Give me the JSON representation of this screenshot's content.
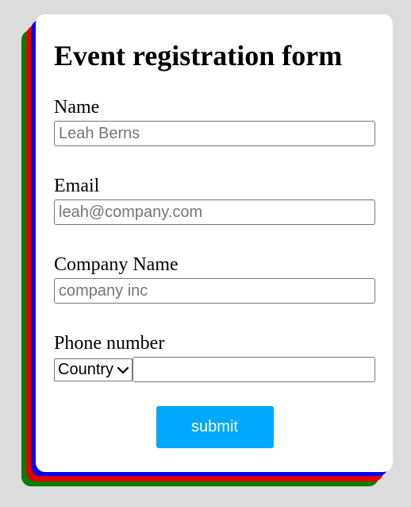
{
  "colors": {
    "background": "#dcdcdc",
    "card": "#ffffff",
    "shadow_green": "#008000",
    "shadow_red": "#e00000",
    "shadow_blue": "#0000ee",
    "submit_button": "#00a8ff"
  },
  "form": {
    "title": "Event registration form",
    "fields": {
      "name": {
        "label": "Name",
        "placeholder": "Leah Berns",
        "value": ""
      },
      "email": {
        "label": "Email",
        "placeholder": "leah@company.com",
        "value": ""
      },
      "company": {
        "label": "Company Name",
        "placeholder": "company inc",
        "value": ""
      },
      "phone": {
        "label": "Phone number",
        "country_selected": "Country",
        "country_icon": "chevron-down-icon",
        "value": ""
      }
    },
    "submit_label": "submit"
  }
}
